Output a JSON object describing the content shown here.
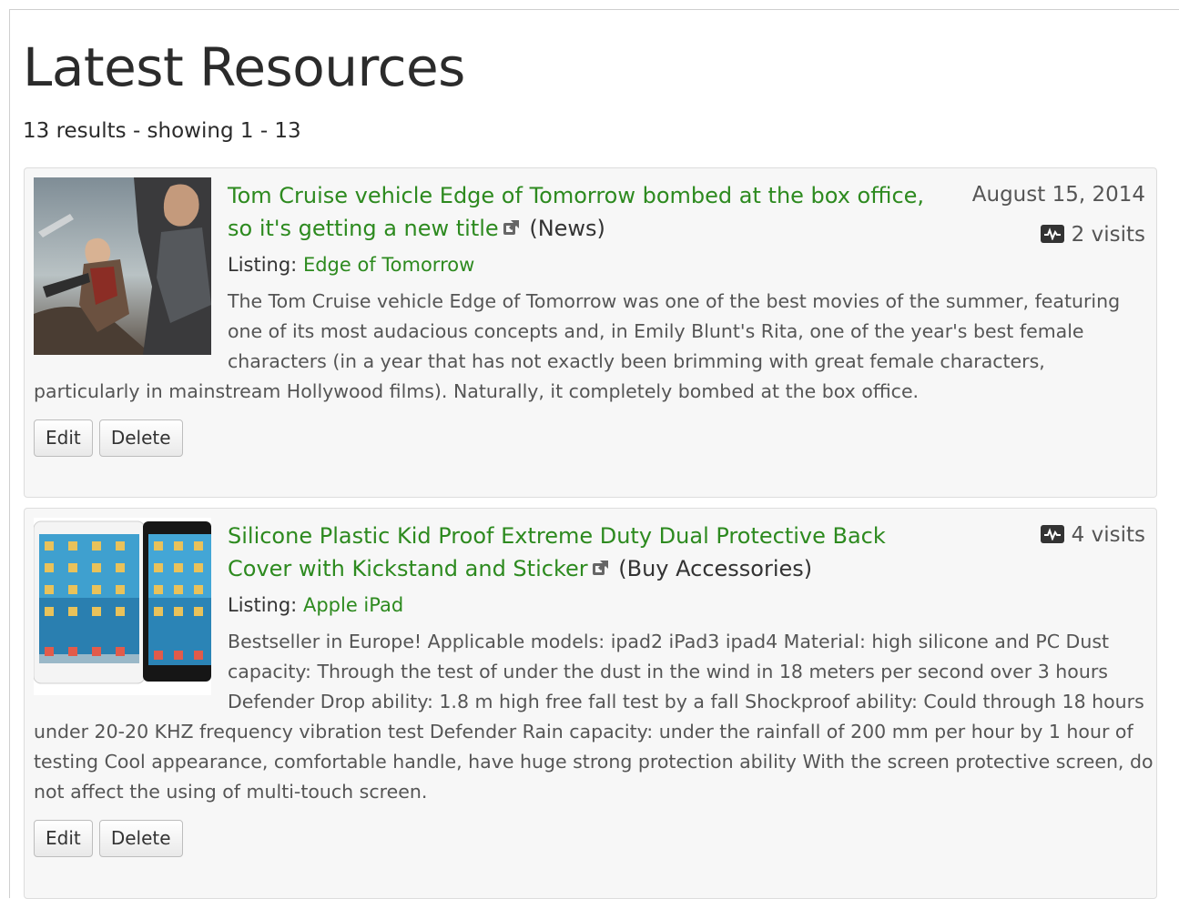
{
  "page": {
    "title": "Latest Resources",
    "results": "13 results - showing 1 - 13"
  },
  "colors": {
    "link_green": "#2d8a1f",
    "card_bg": "#f7f7f7",
    "muted_text": "#555555"
  },
  "resources": [
    {
      "title": "Tom Cruise vehicle Edge of Tomorrow bombed at the box office, so it's getting a new title",
      "category": "(News)",
      "listing_label": "Listing:",
      "listing": "Edge of Tomorrow",
      "description": "The Tom Cruise vehicle Edge of Tomorrow was one of the best movies of the summer, featuring one of its most audacious concepts and, in Emily Blunt's Rita, one of the year's best female characters (in a year that has not exactly been brimming with great female characters, particularly in mainstream Hollywood films). Naturally, it completely bombed at the box office.",
      "date": "August 15, 2014",
      "visits": "2 visits",
      "edit_label": "Edit",
      "delete_label": "Delete",
      "thumbnail_icon": "movie-poster-image"
    },
    {
      "title": "Silicone Plastic Kid Proof Extreme Duty Dual Protective Back Cover with Kickstand and Sticker",
      "category": "(Buy Accessories)",
      "listing_label": "Listing:",
      "listing": "Apple iPad",
      "description": "Bestseller in Europe! Applicable models: ipad2 iPad3 ipad4 Material: high silicone and PC Dust capacity: Through the test of under the dust in the wind in 18 meters per second over 3 hours Defender Drop ability: 1.8 m high free fall test by a fall Shockproof ability: Could through 18 hours under 20-20 KHZ frequency vibration test Defender Rain capacity: under the rainfall of 200 mm per hour by 1 hour of testing Cool appearance, comfortable handle, have huge strong protection ability With the screen protective screen, do not affect the using of multi-touch screen.",
      "visits": "4 visits",
      "edit_label": "Edit",
      "delete_label": "Delete",
      "thumbnail_icon": "ipad-product-image"
    }
  ]
}
